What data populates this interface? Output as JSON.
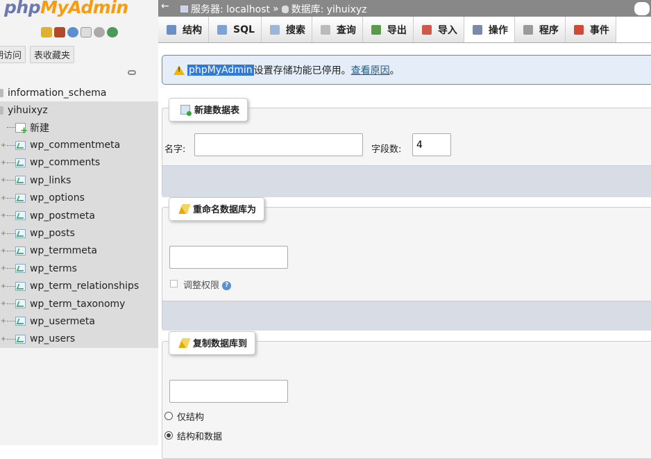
{
  "nav": {
    "logo_php": "php",
    "logo_myadmin": "MyAdmin",
    "tabs": [
      "期访问",
      "表收藏夹"
    ],
    "databases": [
      {
        "name": "information_schema"
      },
      {
        "name": "yihuixyz"
      }
    ],
    "new_label": "新建",
    "tables": [
      "wp_commentmeta",
      "wp_comments",
      "wp_links",
      "wp_options",
      "wp_postmeta",
      "wp_posts",
      "wp_termmeta",
      "wp_terms",
      "wp_term_relationships",
      "wp_term_taxonomy",
      "wp_usermeta",
      "wp_users"
    ]
  },
  "topbar": {
    "server": "服务器: localhost",
    "sep": "»",
    "database": "数据库: yihuixyz"
  },
  "tabs": [
    {
      "label": "结构",
      "icon": "structure-icon",
      "color": "#6b8fc4"
    },
    {
      "label": "SQL",
      "icon": "sql-icon",
      "color": "#7fa2d6"
    },
    {
      "label": "搜索",
      "icon": "search-icon",
      "color": "#9bb6d8"
    },
    {
      "label": "查询",
      "icon": "query-icon",
      "color": "#bbbbbb"
    },
    {
      "label": "导出",
      "icon": "export-icon",
      "color": "#5a9a4a"
    },
    {
      "label": "导入",
      "icon": "import-icon",
      "color": "#d05a4a"
    },
    {
      "label": "操作",
      "icon": "wrench-icon",
      "color": "#7a8aa8",
      "active": true
    },
    {
      "label": "程序",
      "icon": "routines-icon",
      "color": "#9a9a9a"
    },
    {
      "label": "事件",
      "icon": "clock-icon",
      "color": "#d04a3a"
    }
  ],
  "notice": {
    "highlight": "phpMyAdmin",
    "text": "设置存储功能已停用。",
    "link": "查看原因",
    "end": "。"
  },
  "create_table": {
    "legend": "新建数据表",
    "name_label": "名字:",
    "name_value": "",
    "fields_label": "字段数:",
    "fields_value": "4"
  },
  "rename_db": {
    "legend": "重命名数据库为",
    "value": "",
    "adjust_privileges": "调整权限"
  },
  "copy_db": {
    "legend": "复制数据库到",
    "value": "",
    "options": [
      "仅结构",
      "结构和数据"
    ],
    "selected": "结构和数据"
  },
  "colors": {
    "accent": "#2f7bd7",
    "logo_php": "#6c78af",
    "logo_myadmin": "#f89c0e"
  }
}
